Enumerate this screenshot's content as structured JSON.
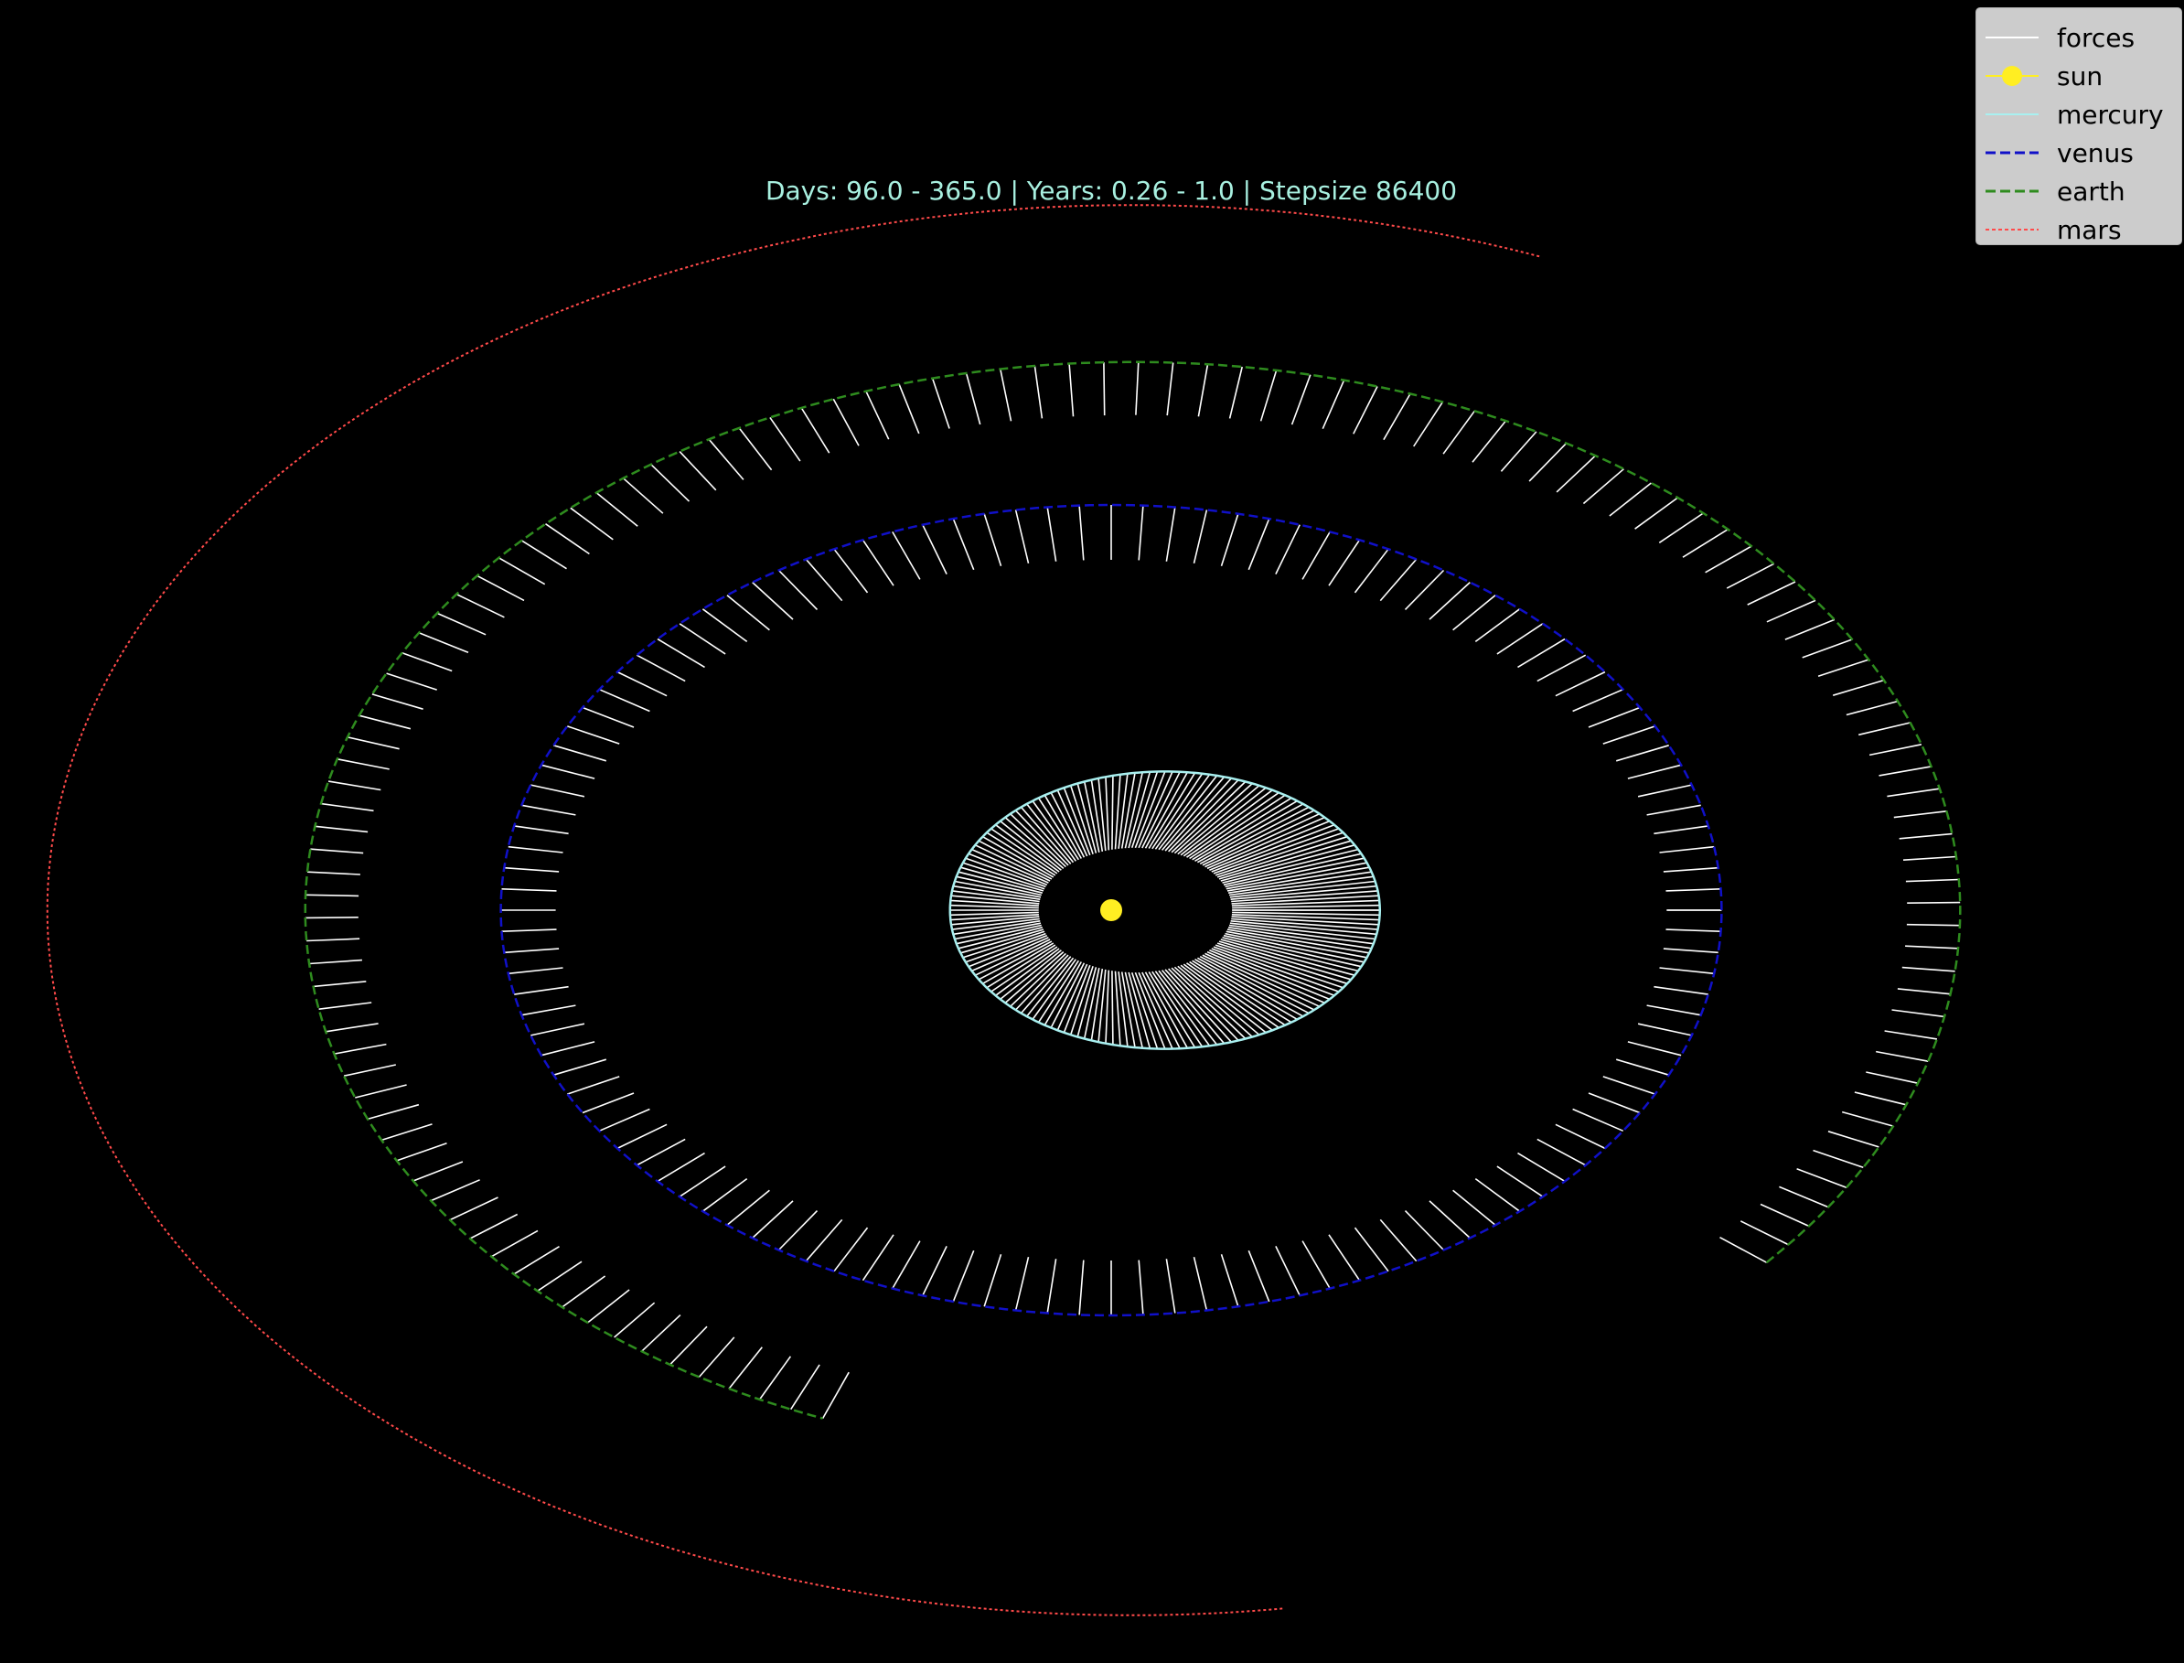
{
  "chart_data": {
    "type": "line",
    "title": "Days: 96.0 - 365.0 | Years: 0.26 - 1.0 | Stepsize 86400",
    "title_color": "#a8f0e0",
    "background": "#000000",
    "grid": false,
    "legend_placement": "top-right",
    "series": [
      {
        "name": "forces",
        "color": "#ffffff",
        "style": "solid"
      },
      {
        "name": "sun",
        "color": "#ffee22",
        "style": "marker"
      },
      {
        "name": "mercury",
        "color": "#a8f0f0",
        "style": "solid",
        "orbit": {
          "cx": 0.25,
          "cy": 0,
          "rx": 1.0,
          "ry": 0.645,
          "theta_start": 0,
          "theta_end": 360
        }
      },
      {
        "name": "venus",
        "color": "#1010c8",
        "style": "dashed",
        "orbit": {
          "cx": 0.0,
          "cy": 0,
          "rx": 2.84,
          "ry": 1.885,
          "theta_start": 0,
          "theta_end": 360
        }
      },
      {
        "name": "earth",
        "color": "#2e8b1e",
        "style": "dashed",
        "orbit": {
          "cx": 0.1,
          "cy": 0,
          "rx": 3.85,
          "ry": 2.55,
          "theta_start": -40,
          "theta_end": 248
        }
      },
      {
        "name": "mars",
        "color": "#ff4a4a",
        "style": "dotted",
        "orbit": {
          "cx": 0.1,
          "cy": 0,
          "rx": 5.05,
          "ry": 3.28,
          "theta_start": 68,
          "theta_end": 278
        }
      }
    ],
    "sun_position": [
      0,
      0
    ]
  }
}
